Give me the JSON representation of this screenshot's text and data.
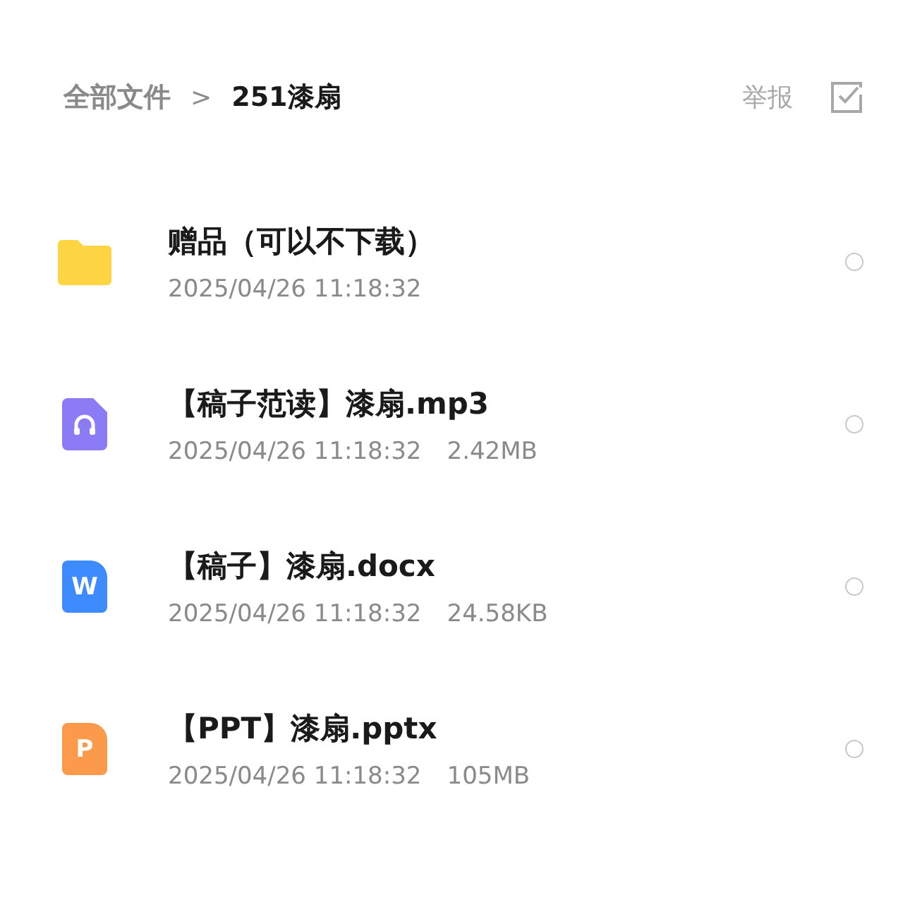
{
  "breadcrumb": {
    "root": "全部文件",
    "separator": ">",
    "current": "251漆扇"
  },
  "header_actions": {
    "report": "举报"
  },
  "files": [
    {
      "kind": "folder",
      "name": "赠品（可以不下载）",
      "date": "2025/04/26 11:18:32",
      "selected": false
    },
    {
      "kind": "audio",
      "name": "【稿子范读】漆扇.mp3",
      "date": "2025/04/26 11:18:32",
      "size": "2.42MB",
      "selected": false
    },
    {
      "kind": "doc",
      "name": "【稿子】漆扇.docx",
      "date": "2025/04/26 11:18:32",
      "size": "24.58KB",
      "icon_letter": "W",
      "selected": false
    },
    {
      "kind": "ppt",
      "name": "【PPT】漆扇.pptx",
      "date": "2025/04/26 11:18:32",
      "size": "105MB",
      "icon_letter": "P",
      "selected": false
    }
  ]
}
